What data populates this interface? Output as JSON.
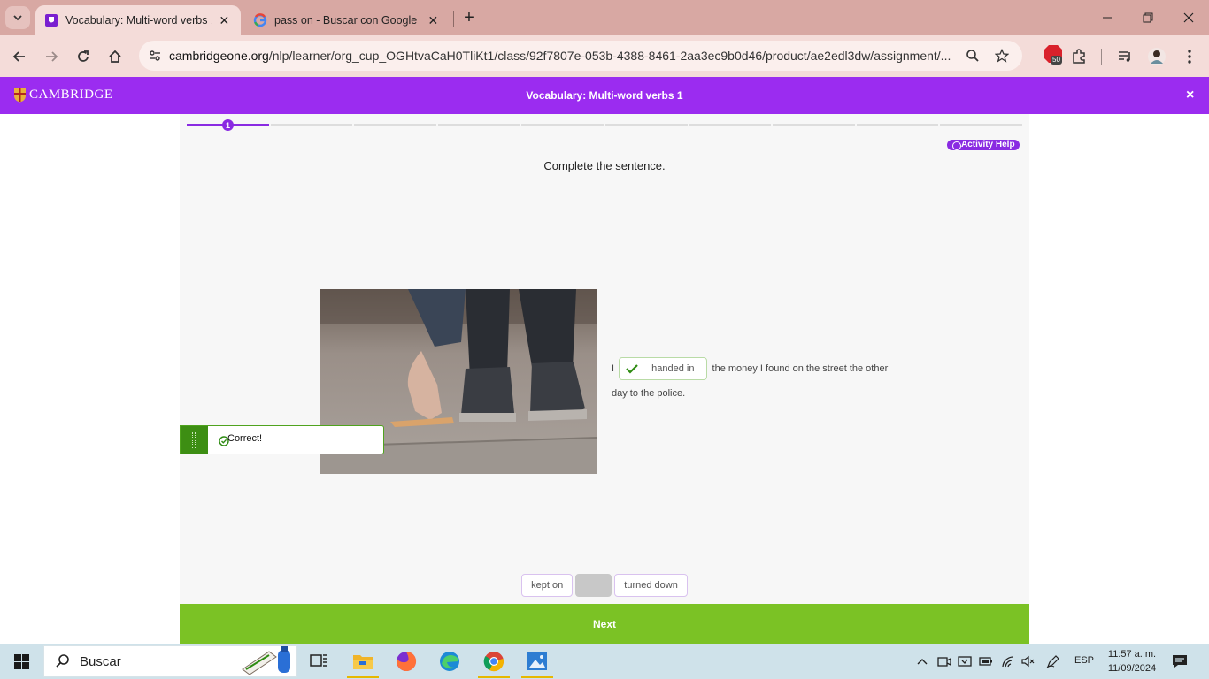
{
  "browser": {
    "tabs": [
      {
        "title": "Vocabulary: Multi-word verbs 1",
        "active": true
      },
      {
        "title": "pass on - Buscar con Google",
        "active": false
      }
    ],
    "url_domain": "cambridgeone.org",
    "url_path": "/nlp/learner/org_cup_OGHtvaCaH0TliKt1/class/92f7807e-053b-4388-8461-2aa3ec9b0d46/product/ae2edl3dw/assignment/...",
    "extension_badge": "50"
  },
  "app": {
    "logo": "CAMBRIDGE",
    "title": "Vocabulary: Multi-word verbs 1",
    "close_label": "×",
    "brand_color": "#9b2cf0"
  },
  "activity": {
    "progress": {
      "current": "1",
      "total_segments": 10
    },
    "help_label": "Activity Help",
    "instruction": "Complete the sentence.",
    "sentence_before": "I",
    "answer": "handed in",
    "sentence_after": "the money I found on the street the other day to the police.",
    "feedback": "Correct!",
    "options": [
      "kept on",
      "turned down"
    ],
    "next_label": "Next"
  },
  "taskbar": {
    "search_placeholder": "Buscar",
    "language": "ESP",
    "time": "11:57 a. m.",
    "date": "11/09/2024"
  }
}
